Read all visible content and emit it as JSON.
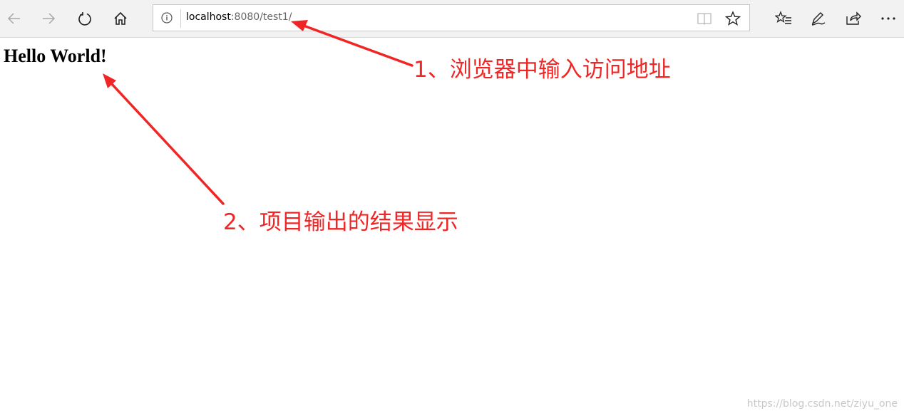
{
  "browser": {
    "url_host": "localhost",
    "url_rest": ":8080/test1/",
    "icons": {
      "back": "back-arrow-icon",
      "forward": "forward-arrow-icon",
      "refresh": "refresh-icon",
      "home": "home-icon",
      "info": "info-icon",
      "reading_view": "reading-view-icon",
      "favorite": "star-icon",
      "favorites_hub": "favorites-list-icon",
      "web_note": "pen-icon",
      "share": "share-icon",
      "more": "more-dots-icon"
    }
  },
  "page": {
    "heading": "Hello World!"
  },
  "annotations": {
    "label1": "1、浏览器中输入访问地址",
    "label2": "2、项目输出的结果显示",
    "color": "#f02626"
  },
  "watermark": "https://blog.csdn.net/ziyu_one"
}
